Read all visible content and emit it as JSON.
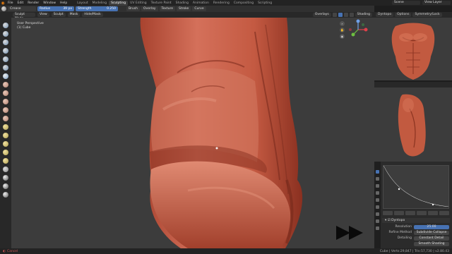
{
  "menu": {
    "items": [
      "File",
      "Edit",
      "Render",
      "Window",
      "Help"
    ],
    "workspaces": [
      "Layout",
      "Modeling",
      "Sculpting",
      "UV Editing",
      "Texture Paint",
      "Shading",
      "Animation",
      "Rendering",
      "Compositing",
      "Scripting"
    ],
    "active_workspace": "Sculpting",
    "scene": "Scene",
    "view_layer": "View Layer"
  },
  "tool_header": {
    "brush": "Crease",
    "radius_label": "Radius",
    "radius_value": "39 px",
    "strength_label": "Strength",
    "strength_value": "0.250",
    "menus": [
      "Brush",
      "Overlay",
      "Texture",
      "Stroke",
      "Curve"
    ]
  },
  "viewport_header": {
    "mode": "Sculpt Mode",
    "menus": [
      "View",
      "Sculpt",
      "Mask",
      "Hide/Mask"
    ],
    "overlays": "Overlays",
    "shading": "Shading"
  },
  "viewport": {
    "view_name": "User Perspective",
    "object_name": "(1) Cube"
  },
  "refs_header": {
    "dyntopo": "Dyntopo",
    "options": "Options",
    "symmetry": "Symmetry/Lock"
  },
  "properties": {
    "panel_title": "Dyntopo",
    "resolution_label": "Resolution",
    "resolution_value": "25.00",
    "refine_label": "Refine Method",
    "refine_value": "Subdivide Collapse",
    "detailing_label": "Detailing",
    "detailing_value": "Constant Detail",
    "smooth_shading": "Smooth Shading"
  },
  "status": {
    "cancel": "Cancel",
    "stats": "Cube | Verts:29,847 | Tris:57,730 | v2.80.43"
  },
  "colors": {
    "accent": "#4772b3",
    "viewport_bg": "#3c3c3c",
    "clay": "#c45a42",
    "logo": "#e87d0d"
  },
  "icons": [
    "blender-logo",
    "brush-icon",
    "gizmo-axes",
    "fast-forward-icon"
  ]
}
